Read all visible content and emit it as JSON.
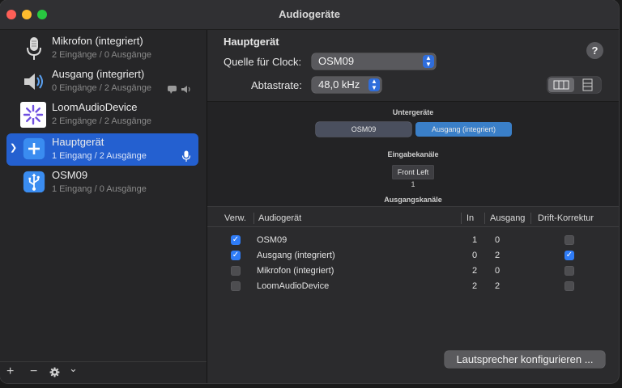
{
  "window": {
    "title": "Audiogeräte"
  },
  "sidebar": {
    "devices": [
      {
        "name": "Mikrofon (integriert)",
        "sub": "2 Eingänge / 0 Ausgänge",
        "icon": "microphone-icon"
      },
      {
        "name": "Ausgang (integriert)",
        "sub": "0 Eingänge / 2 Ausgänge",
        "icon": "speaker-icon"
      },
      {
        "name": "LoomAudioDevice",
        "sub": "2 Eingänge / 2 Ausgänge",
        "icon": "loom-logo-icon"
      },
      {
        "name": "Hauptgerät",
        "sub": "1 Eingang / 2 Ausgänge",
        "icon": "aggregate-plus-icon",
        "selected": true
      },
      {
        "name": "OSM09",
        "sub": "1 Eingang / 0 Ausgänge",
        "icon": "usb-icon"
      }
    ],
    "footer": {
      "add": "+",
      "remove": "−",
      "more": "⌄"
    }
  },
  "main": {
    "heading": "Hauptgerät",
    "clock_label": "Quelle für Clock:",
    "clock_value": "OSM09",
    "rate_label": "Abtastrate:",
    "rate_value": "48,0 kHz",
    "help": "?"
  },
  "panel": {
    "subdevices_title": "Untergeräte",
    "subdevices": [
      "OSM09",
      "Ausgang (integriert)"
    ],
    "input_channels_title": "Eingabekanäle",
    "channel_name": "Front Left",
    "channel_index": "1",
    "output_channels_title": "Ausgangskanäle"
  },
  "table": {
    "headers": {
      "use": "Verw.",
      "device": "Audiogerät",
      "in": "In",
      "out": "Ausgang",
      "drift": "Drift-Korrektur"
    },
    "rows": [
      {
        "use": true,
        "device": "OSM09",
        "in": "1",
        "out": "0",
        "drift": false
      },
      {
        "use": true,
        "device": "Ausgang (integriert)",
        "in": "0",
        "out": "2",
        "drift": true
      },
      {
        "use": false,
        "device": "Mikrofon (integriert)",
        "in": "2",
        "out": "0",
        "drift": false
      },
      {
        "use": false,
        "device": "LoomAudioDevice",
        "in": "2",
        "out": "2",
        "drift": false
      }
    ]
  },
  "configure_speakers_label": "Lautsprecher konfigurieren ...",
  "colors": {
    "accent": "#2460d0",
    "checkbox": "#2f7cf6",
    "subdevice_active": "#3a7fc8"
  }
}
